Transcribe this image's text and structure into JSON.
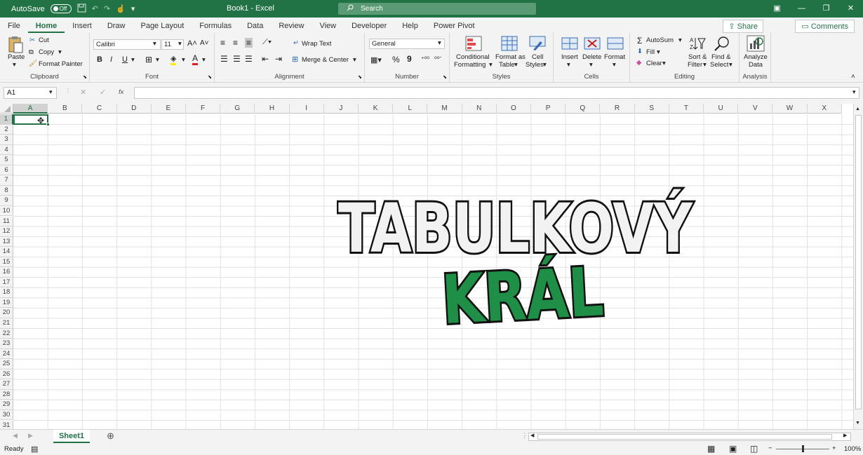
{
  "titlebar": {
    "autosave_label": "AutoSave",
    "autosave_state": "Off",
    "doc_title": "Book1 - Excel",
    "search_placeholder": "Search"
  },
  "tabs": [
    "File",
    "Home",
    "Insert",
    "Draw",
    "Page Layout",
    "Formulas",
    "Data",
    "Review",
    "View",
    "Developer",
    "Help",
    "Power Pivot"
  ],
  "active_tab": "Home",
  "share_label": "Share",
  "comments_label": "Comments",
  "ribbon": {
    "clipboard": {
      "paste": "Paste",
      "cut": "Cut",
      "copy": "Copy",
      "format_painter": "Format Painter",
      "label": "Clipboard"
    },
    "font": {
      "name": "Calibri",
      "size": "11",
      "bold": "B",
      "italic": "I",
      "underline": "U",
      "label": "Font"
    },
    "alignment": {
      "wrap": "Wrap Text",
      "merge": "Merge & Center",
      "label": "Alignment"
    },
    "number": {
      "format": "General",
      "label": "Number"
    },
    "styles": {
      "cond1": "Conditional",
      "cond2": "Formatting",
      "fat1": "Format as",
      "fat2": "Table",
      "cs1": "Cell",
      "cs2": "Styles",
      "label": "Styles"
    },
    "cells": {
      "insert": "Insert",
      "delete": "Delete",
      "format": "Format",
      "label": "Cells"
    },
    "editing": {
      "autosum": "AutoSum",
      "fill": "Fill",
      "clear": "Clear",
      "sort1": "Sort &",
      "sort2": "Filter",
      "find1": "Find &",
      "find2": "Select",
      "label": "Editing"
    },
    "analysis": {
      "a1": "Analyze",
      "a2": "Data",
      "label": "Analysis"
    }
  },
  "formula_bar": {
    "name_box": "A1",
    "fx": "fx",
    "value": ""
  },
  "columns": [
    "A",
    "B",
    "C",
    "D",
    "E",
    "F",
    "G",
    "H",
    "I",
    "J",
    "K",
    "L",
    "M",
    "N",
    "O",
    "P",
    "Q",
    "R",
    "S",
    "T",
    "U",
    "V",
    "W",
    "X"
  ],
  "rows": [
    1,
    2,
    3,
    4,
    5,
    6,
    7,
    8,
    9,
    10,
    11,
    12,
    13,
    14,
    15,
    16,
    17,
    18,
    19,
    20,
    21,
    22,
    23,
    24,
    25,
    26,
    27,
    28,
    29,
    30,
    31
  ],
  "overlay": {
    "line1": "TABULKOVÝ",
    "line2": "KRÁL"
  },
  "sheets": [
    "Sheet1"
  ],
  "status": {
    "ready": "Ready",
    "zoom": "100%"
  }
}
